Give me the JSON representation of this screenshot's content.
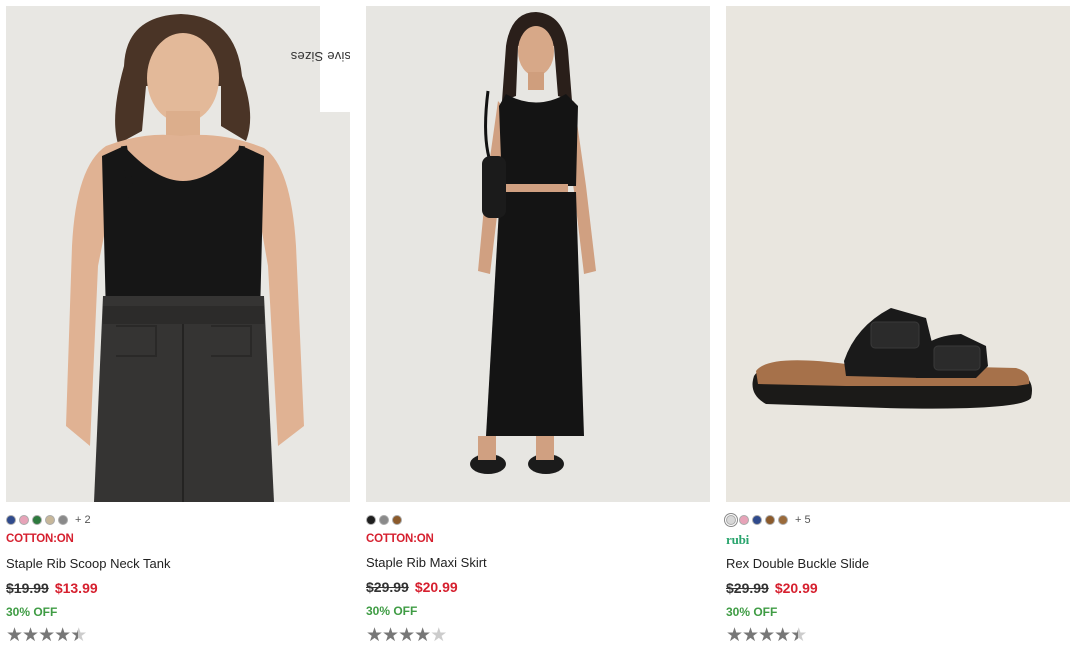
{
  "products": [
    {
      "badge": "Inclusive Sizes",
      "swatches": [
        "#2f4a8c",
        "#e7a3b8",
        "#2e7a3e",
        "#c7b79a",
        "#8a8a8a"
      ],
      "more_colors": "+ 2",
      "brand": "COTTON:ON",
      "name": "Staple Rib Scoop Neck Tank",
      "was_price": "$19.99",
      "now_price": "$13.99",
      "discount": "30% OFF",
      "rating": 4.5,
      "stars": [
        "★",
        "★",
        "★",
        "★",
        "★"
      ]
    },
    {
      "swatches": [
        "#1e1e1e",
        "#8a8a8a",
        "#8b5a2b"
      ],
      "brand": "COTTON:ON",
      "name": "Staple Rib Maxi Skirt",
      "was_price": "$29.99",
      "now_price": "$20.99",
      "discount": "30% OFF",
      "rating": 4,
      "stars": [
        "★",
        "★",
        "★",
        "★",
        "★"
      ]
    },
    {
      "swatches": [
        "#d8d8d8",
        "#e7a3b8",
        "#2f4a8c",
        "#8b5a2b",
        "#9a6a3a"
      ],
      "more_colors": "+ 5",
      "brand": "rubi",
      "name": "Rex Double Buckle Slide",
      "was_price": "$29.99",
      "now_price": "$20.99",
      "discount": "30% OFF",
      "rating": 4.5,
      "stars": [
        "★",
        "★",
        "★",
        "★",
        "★"
      ]
    }
  ],
  "colors": {
    "sale_red": "#d6202f",
    "discount_green": "#3f9c44",
    "rubi_green": "#2aa56e",
    "image_bg": "#e7e6e2"
  }
}
